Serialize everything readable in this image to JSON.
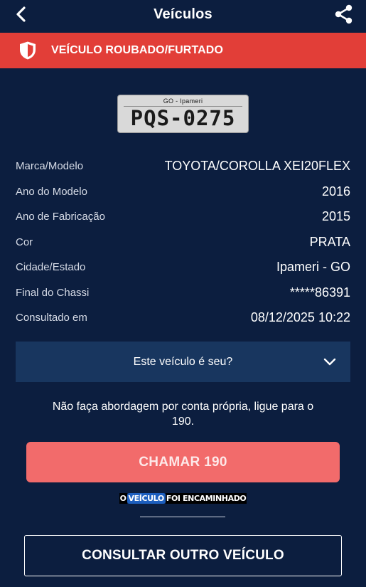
{
  "header": {
    "title": "Veículos",
    "back_icon": "chevron-left-icon",
    "share_icon": "share-icon"
  },
  "alert": {
    "icon": "shield-icon",
    "text": "VEÍCULO ROUBADO/FURTADO",
    "color": "#e23e38"
  },
  "plate": {
    "region": "GO - Ipameri",
    "number": "PQS-0275"
  },
  "details": [
    {
      "label": "Marca/Modelo",
      "value": "TOYOTA/COROLLA XEI20FLEX"
    },
    {
      "label": "Ano do Modelo",
      "value": "2016"
    },
    {
      "label": "Ano de Fabricação",
      "value": "2015"
    },
    {
      "label": "Cor",
      "value": "PRATA"
    },
    {
      "label": "Cidade/Estado",
      "value": "Ipameri - GO"
    },
    {
      "label": "Final do Chassi",
      "value": "*****86391"
    },
    {
      "label": "Consultado em",
      "value": "08/12/2025 10:22"
    }
  ],
  "owner_prompt": {
    "text": "Este veículo é seu?",
    "icon": "chevron-down-icon"
  },
  "warning": "Não faça abordagem por conta própria, ligue para o 190.",
  "call_button": {
    "label": "CHAMAR 190",
    "color": "#f26b6b"
  },
  "caption": {
    "word1": "O",
    "word2": "VEÍCULO",
    "word3": "FOI ENCAMINHADO"
  },
  "other_button": {
    "label": "CONSULTAR OUTRO VEÍCULO"
  },
  "colors": {
    "background": "#0c1e3f",
    "panel": "#18365f"
  }
}
